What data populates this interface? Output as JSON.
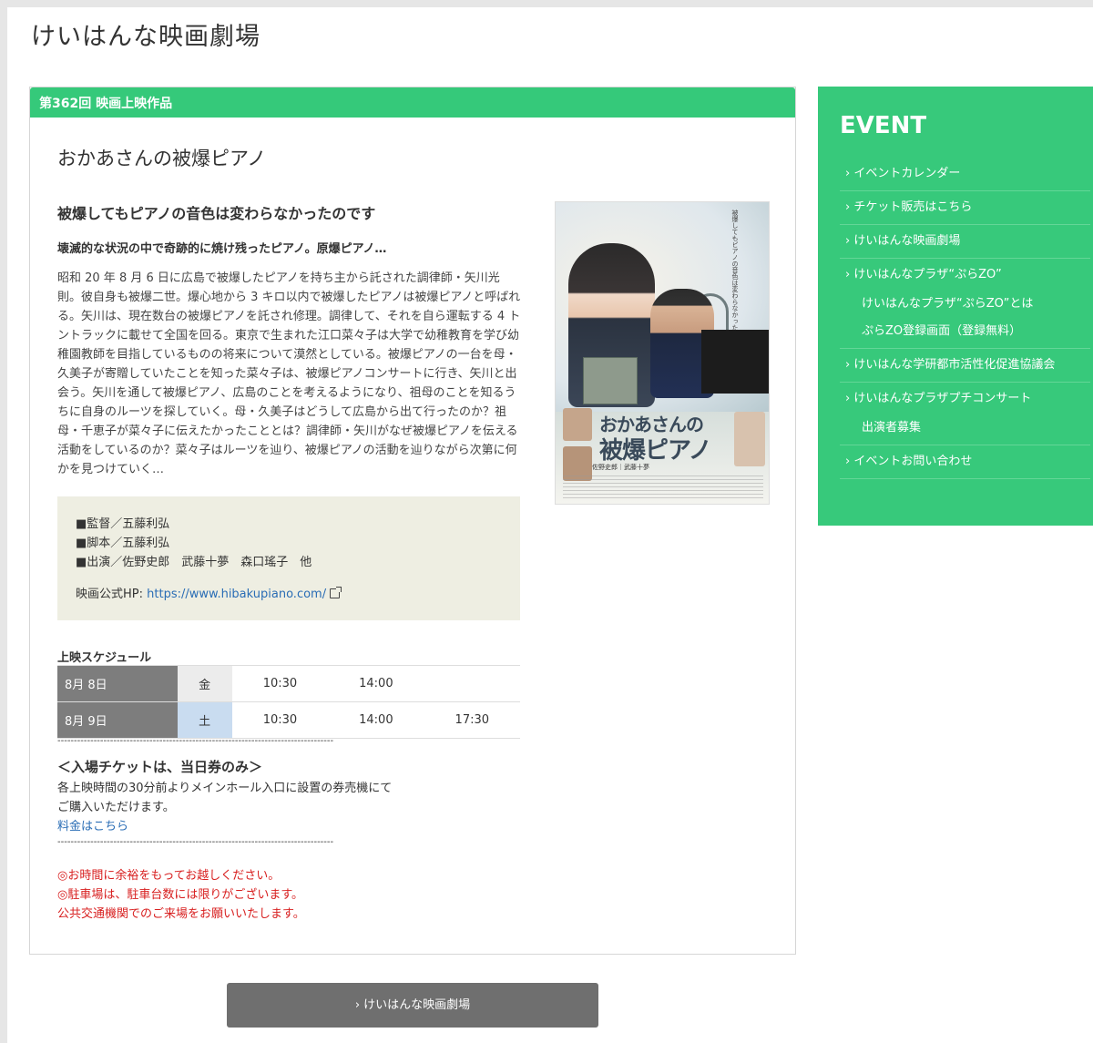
{
  "site": {
    "title": "けいはんな映画劇場"
  },
  "header": {
    "label": "第362回 映画上映作品"
  },
  "movie": {
    "title": "おかあさんの被爆ピアノ",
    "catch": "被爆してもピアノの音色は変わらなかったのです",
    "subcatch": "壊滅的な状況の中で奇跡的に焼け残ったピアノ。原爆ピアノ…",
    "synopsis": "昭和 20 年 8 月 6 日に広島で被爆したピアノを持ち主から託された調律師・矢川光則。彼自身も被爆二世。爆心地から 3 キロ以内で被爆したピアノは被爆ピアノと呼ばれる。矢川は、現在数台の被爆ピアノを託され修理。調律して、それを自ら運転する 4 トントラックに載せて全国を回る。東京で生まれた江口菜々子は大学で幼稚教育を学び幼稚園教師を目指しているものの将来について漠然としている。被爆ピアノの一台を母・久美子が寄贈していたことを知った菜々子は、被爆ピアノコンサートに行き、矢川と出会う。矢川を通して被爆ピアノ、広島のことを考えるようになり、祖母のことを知るうちに自身のルーツを探していく。母・久美子はどうして広島から出て行ったのか？祖母・千恵子が菜々子に伝えたかったこととは？調律師・矢川がなぜ被爆ピアノを伝える活動をしているのか？菜々子はルーツを辿り、被爆ピアノの活動を辿りながら次第に何かを見つけていく…",
    "credits": {
      "director": "■監督／五藤利弘",
      "writer": "■脚本／五藤利弘",
      "cast": "■出演／佐野史郎　武藤十夢　森口瑤子　他",
      "hp_label": "映画公式HP: ",
      "hp_url": "https://www.hibakupiano.com/"
    }
  },
  "poster": {
    "vertical_text": "被爆してもピアノの音色は変わらなかったのです",
    "title_line1": "おかあさんの",
    "title_line2": "被爆ピアノ",
    "cast_line": "佐野史郎｜武藤十夢"
  },
  "schedule": {
    "title": "上映スケジュール",
    "rows": [
      {
        "date": "8月 8日",
        "dow": "金",
        "times": [
          "10:30",
          "14:00",
          ""
        ]
      },
      {
        "date": "8月 9日",
        "dow": "土",
        "times": [
          "10:30",
          "14:00",
          "17:30"
        ]
      }
    ]
  },
  "separator": "------------------------------------------------------------------------------------",
  "ticket": {
    "heading": "＜入場チケットは、当日券のみ＞",
    "line1": "各上映時間の30分前よりメインホール入口に設置の券売機にて",
    "line2": "ご購入いただけます。",
    "link": "料金はこちら"
  },
  "notice": {
    "line1": "◎お時間に余裕をもってお越しください。",
    "line2": "◎駐車場は、駐車台数には限りがございます。",
    "line3": "公共交通機関でのご来場をお願いいたします。"
  },
  "sidebar": {
    "title": "EVENT",
    "items": [
      {
        "label": "› イベントカレンダー"
      },
      {
        "label": "› チケット販売はこちら"
      },
      {
        "label": "› けいはんな映画劇場"
      },
      {
        "label": "› けいはんなプラザ“ぷらZO”",
        "sub1": "けいはんなプラザ“ぷらZO”とは",
        "sub2": "ぷらZO登録画面（登録無料）"
      },
      {
        "label": "› けいはんな学研都市活性化促進協議会"
      },
      {
        "label": "› けいはんなプラザプチコンサート",
        "sub1": "出演者募集"
      },
      {
        "label": "› イベントお問い合わせ"
      }
    ]
  },
  "footer_button": {
    "label": "› けいはんな映画劇場"
  },
  "colors": {
    "accent_green": "#37c97b",
    "notice_red": "#d82020",
    "link_blue": "#2a6db5"
  }
}
